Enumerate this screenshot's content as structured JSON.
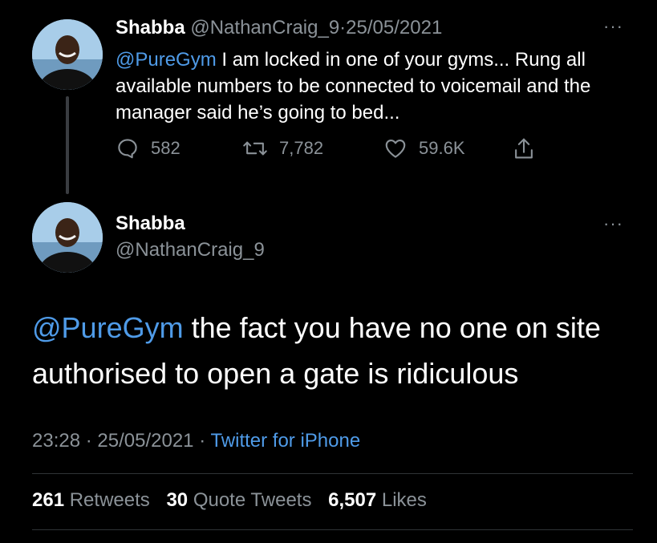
{
  "tweet1": {
    "name": "Shabba",
    "handle": "@NathanCraig_9",
    "separator": "·",
    "date": "25/05/2021",
    "mention": "@PureGym",
    "text": " I am locked in one of your gyms... Rung all available numbers to be connected to voicemail and the manager said he’s going to bed...",
    "replies": "582",
    "retweets": "7,782",
    "likes": "59.6K",
    "more": "···"
  },
  "tweet2": {
    "name": "Shabba",
    "handle": "@NathanCraig_9",
    "mention": "@PureGym",
    "text": " the fact you have no one on site authorised to open a gate is ridiculous",
    "more": "···",
    "time": "23:28",
    "dot1": "·",
    "date": "25/05/2021",
    "dot2": "·",
    "source": "Twitter for iPhone",
    "stats": {
      "retweets_count": "261",
      "retweets_label": "Retweets",
      "quotes_count": "30",
      "quotes_label": "Quote Tweets",
      "likes_count": "6,507",
      "likes_label": "Likes"
    }
  },
  "colors": {
    "background": "#000000",
    "text": "#ffffff",
    "muted": "#8b9298",
    "link": "#4f9be8",
    "divider": "#2f3336"
  },
  "icons": [
    "avatar",
    "more-icon",
    "reply-icon",
    "retweet-icon",
    "like-icon",
    "share-icon"
  ]
}
